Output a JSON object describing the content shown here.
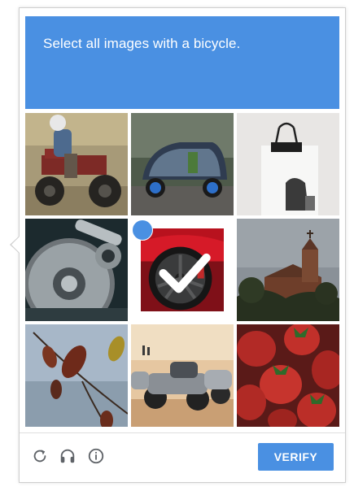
{
  "challenge": {
    "instruction": "Select all images with a bicycle.",
    "accent_color": "#4a90e2"
  },
  "tiles": [
    {
      "subject": "atv-quad-bike-rider",
      "selected": false
    },
    {
      "subject": "three-wheel-electric-vehicle",
      "selected": false
    },
    {
      "subject": "binder-clip-on-paper",
      "selected": false
    },
    {
      "subject": "hard-drive-platter",
      "selected": false
    },
    {
      "subject": "red-car-wheel",
      "selected": true
    },
    {
      "subject": "church-on-hill",
      "selected": false
    },
    {
      "subject": "autumn-leaves-branch",
      "selected": false
    },
    {
      "subject": "parked-motorcycles",
      "selected": false
    },
    {
      "subject": "strawberries",
      "selected": false
    }
  ],
  "footer": {
    "icons": [
      "reload-icon",
      "audio-headphones-icon",
      "info-icon"
    ],
    "verify_label": "VERIFY"
  }
}
